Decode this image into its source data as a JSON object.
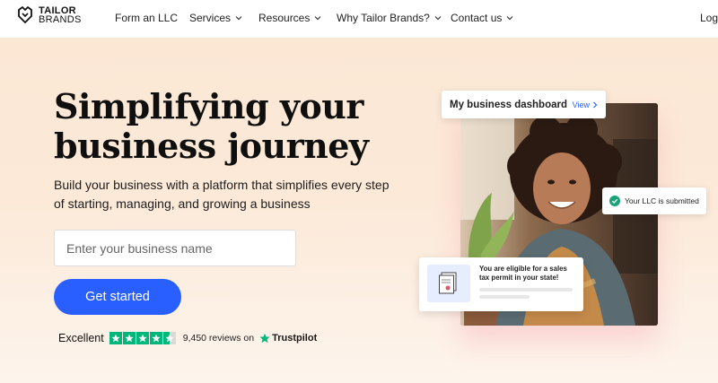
{
  "brand": {
    "line1": "TAILOR",
    "line2": "BRANDS"
  },
  "nav": {
    "items": [
      {
        "label": "Form an LLC",
        "dropdown": false
      },
      {
        "label": "Services",
        "dropdown": true
      },
      {
        "label": "Resources",
        "dropdown": true
      },
      {
        "label": "Why Tailor Brands?",
        "dropdown": true
      },
      {
        "label": "Contact us",
        "dropdown": true
      }
    ],
    "login_label": "Log"
  },
  "hero": {
    "headline_line1": "Simplifying your",
    "headline_line2": "business journey",
    "subheadline": "Build your business with a platform that simplifies every step of starting, managing, and growing a business",
    "input_placeholder": "Enter your business name",
    "cta_label": "Get started"
  },
  "rating": {
    "label": "Excellent",
    "stars": 4.5,
    "reviews_text": "9,450 reviews on",
    "provider": "Trustpilot"
  },
  "dashboard_card": {
    "title": "My business dashboard",
    "link_label": "View"
  },
  "llc_card": {
    "text": "Your LLC is submitted"
  },
  "tax_card": {
    "text": "You are eligible for a sales tax permit in your state!"
  },
  "colors": {
    "accent": "#2a5fff",
    "trustpilot_green": "#00b67a",
    "hero_bg": "#fbe7d4"
  }
}
